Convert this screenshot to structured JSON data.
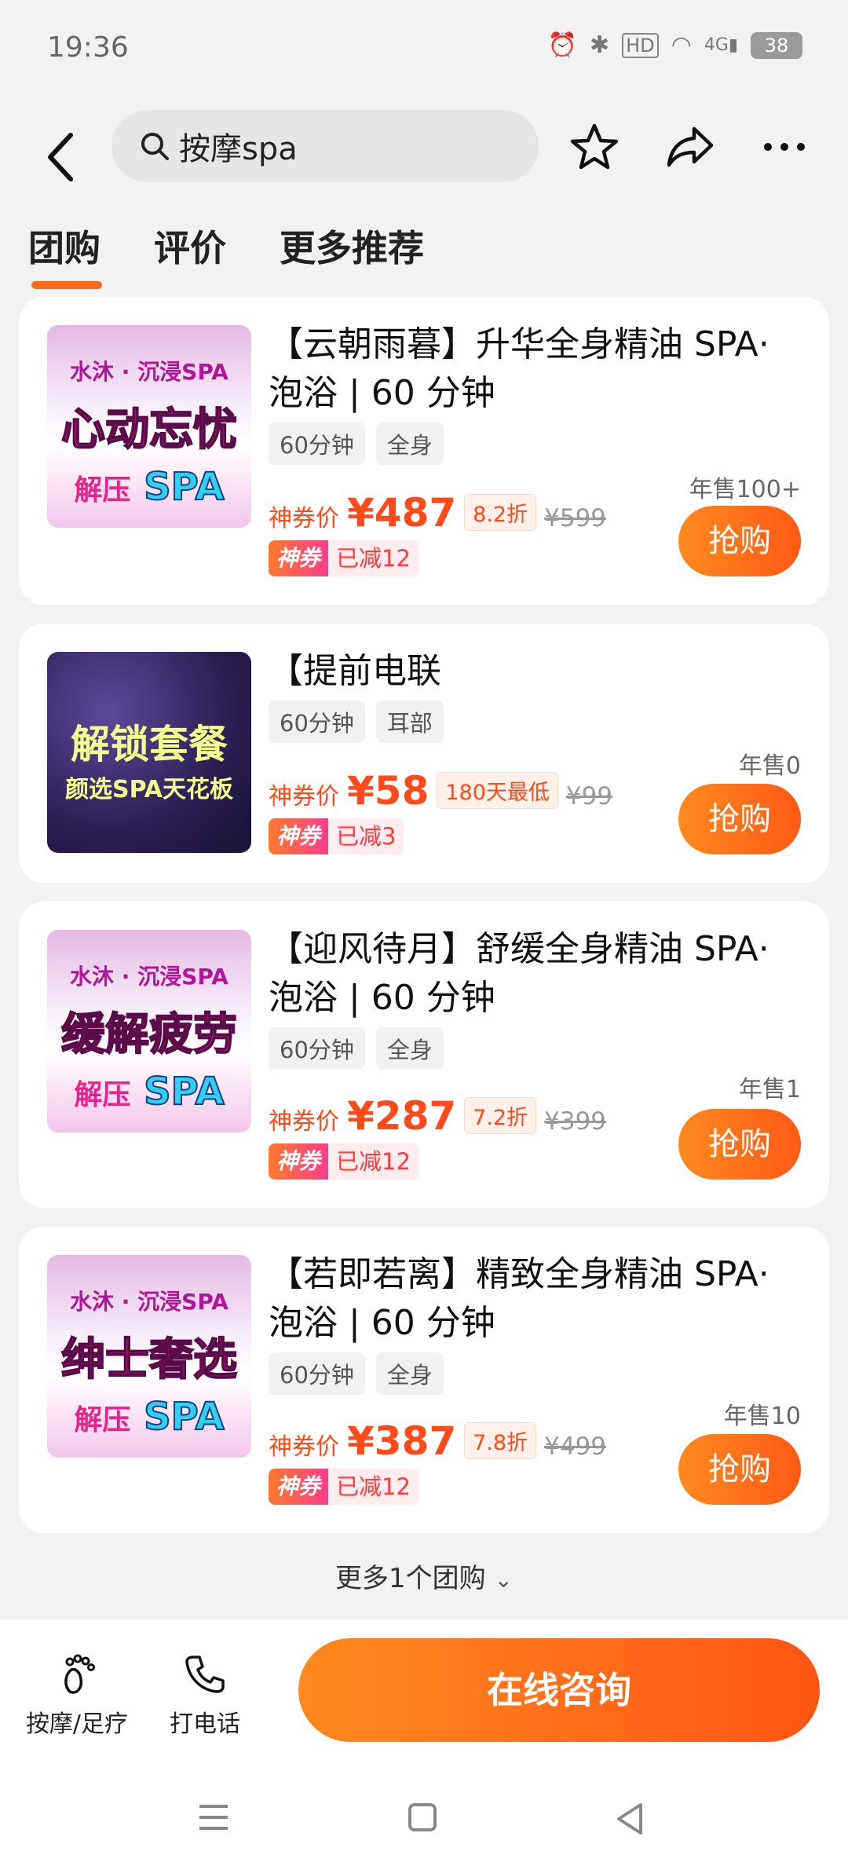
{
  "status_bar": {
    "time": "19:36",
    "battery": "38",
    "hd": "HD",
    "network": "4G"
  },
  "header": {
    "search_text": "按摩spa"
  },
  "tabs": [
    {
      "label": "团购"
    },
    {
      "label": "评价"
    },
    {
      "label": "更多推荐"
    }
  ],
  "deals": [
    {
      "title": "【云朝雨暮】升华全身精油 SPA·泡浴 | 60 分钟",
      "tags": [
        "60分钟",
        "全身"
      ],
      "price_label": "神券价",
      "price": "¥487",
      "discount": "8.2折",
      "original": "¥599",
      "coupon_badge": "神券",
      "coupon_text": "已减12",
      "sold": "年售100+",
      "buy": "抢购",
      "thumb_line1": "水沐 · 沉浸SPA",
      "thumb_line2": "心动忘忧",
      "thumb_line3a": "解压",
      "thumb_line3b": "SPA"
    },
    {
      "title": "【提前电联",
      "tags": [
        "60分钟",
        "耳部"
      ],
      "price_label": "神券价",
      "price": "¥58",
      "discount": "180天最低",
      "original": "¥99",
      "coupon_badge": "神券",
      "coupon_text": "已减3",
      "sold": "年售0",
      "buy": "抢购",
      "thumb_line1": "解锁套餐",
      "thumb_line2": "颜选SPA天花板"
    },
    {
      "title": "【迎风待月】舒缓全身精油 SPA·泡浴 | 60 分钟",
      "tags": [
        "60分钟",
        "全身"
      ],
      "price_label": "神券价",
      "price": "¥287",
      "discount": "7.2折",
      "original": "¥399",
      "coupon_badge": "神券",
      "coupon_text": "已减12",
      "sold": "年售1",
      "buy": "抢购",
      "thumb_line1": "水沐 · 沉浸SPA",
      "thumb_line2": "缓解疲劳",
      "thumb_line3a": "解压",
      "thumb_line3b": "SPA"
    },
    {
      "title": "【若即若离】精致全身精油 SPA·泡浴 | 60 分钟",
      "tags": [
        "60分钟",
        "全身"
      ],
      "price_label": "神券价",
      "price": "¥387",
      "discount": "7.8折",
      "original": "¥499",
      "coupon_badge": "神券",
      "coupon_text": "已减12",
      "sold": "年售10",
      "buy": "抢购",
      "thumb_line1": "水沐 · 沉浸SPA",
      "thumb_line2": "绅士奢选",
      "thumb_line3a": "解压",
      "thumb_line3b": "SPA"
    }
  ],
  "more_link": "更多1个团购",
  "bottom": {
    "category": "按摩/足疗",
    "call": "打电话",
    "consult": "在线咨询"
  },
  "colors": {
    "accent": "#ff5a14",
    "price": "#ff4a1a"
  }
}
